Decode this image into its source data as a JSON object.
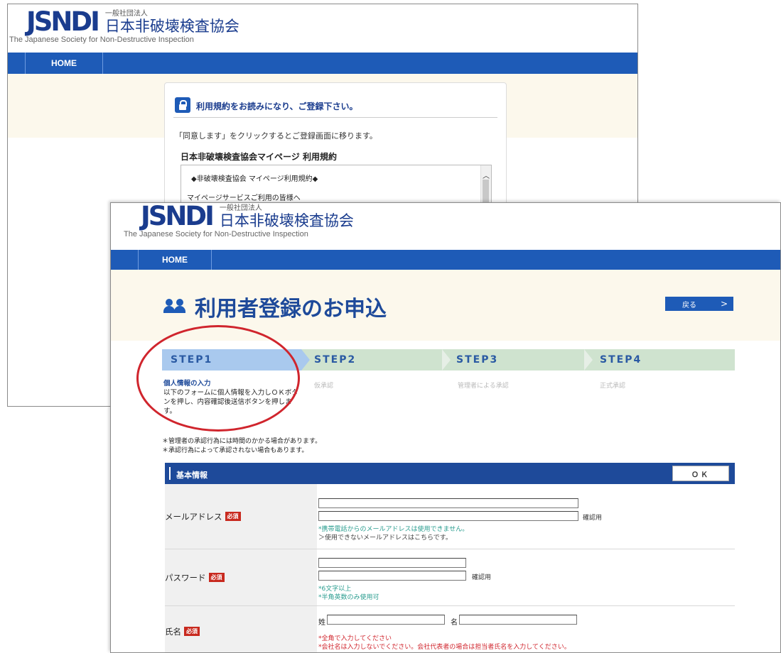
{
  "back_window": {
    "logo": {
      "mark": "JSNDI",
      "small": "一般社団法人",
      "jp": "日本非破壊検査協会",
      "en": "The Japanese Society for Non-Destructive Inspection"
    },
    "nav": {
      "home": "HOME"
    },
    "card": {
      "title": "利用規約をお読みになり、ご登録下さい。",
      "description": "「同意します」をクリックするとご登録画面に移ります。",
      "terms_heading": "日本非破壊検査協会マイページ 利用規約",
      "terms_line1": "◆非破壊検査協会 マイページ利用規約◆",
      "terms_line2": "マイページサービスご利用の皆様へ"
    }
  },
  "front_window": {
    "logo": {
      "mark": "JSNDI",
      "small": "一般社団法人",
      "jp": "日本非破壊検査協会",
      "en": "The Japanese Society for Non-Destructive Inspection"
    },
    "nav": {
      "home": "HOME"
    },
    "page_title": "利用者登録のお申込",
    "back_button": {
      "label": "戻る",
      "chevron": ">"
    },
    "steps": [
      {
        "label": "STEP1",
        "desc": "個人情報の入力"
      },
      {
        "label": "STEP2",
        "desc": "仮承認"
      },
      {
        "label": "STEP3",
        "desc": "管理者による承認"
      },
      {
        "label": "STEP4",
        "desc": "正式承認"
      }
    ],
    "step1_desc_text": "以下のフォームに個人情報を入力しＯＫボタンを押し、内容確認後送信ボタンを押します。",
    "notes": [
      "＊管理者の承認行為には時間のかかる場合があります。",
      "＊承認行為によって承認されない場合もあります。"
    ],
    "form": {
      "section_title": "基本情報",
      "ok_label": "ＯＫ",
      "required_badge": "必須",
      "confirm_label": "確認用",
      "email": {
        "label": "メールアドレス",
        "hint1": "*携帯電話からのメールアドレスは使用できません。",
        "hint2": "＞使用できないメールアドレスはこちらです。"
      },
      "password": {
        "label": "パスワード",
        "hint1": "*6文字以上",
        "hint2": "*半角英数のみ使用可"
      },
      "name": {
        "label": "氏名",
        "last_label": "姓",
        "first_label": "名",
        "hint1": "*全角で入力してください",
        "hint2": "*会社名は入力しないでください。会社代表者の場合は担当者氏名を入力してください。"
      }
    }
  },
  "colors": {
    "brand_blue": "#1e5bb7",
    "dark_blue": "#1e4a9a",
    "cream": "#fcf8ec",
    "step_green": "#cfe3cf",
    "step_active": "#a9c9ee",
    "required_red": "#c8291e",
    "annotation_red": "#d0252d"
  },
  "icons": [
    "lock-icon",
    "users-icon",
    "chevron-right-icon",
    "chevron-up-icon"
  ]
}
